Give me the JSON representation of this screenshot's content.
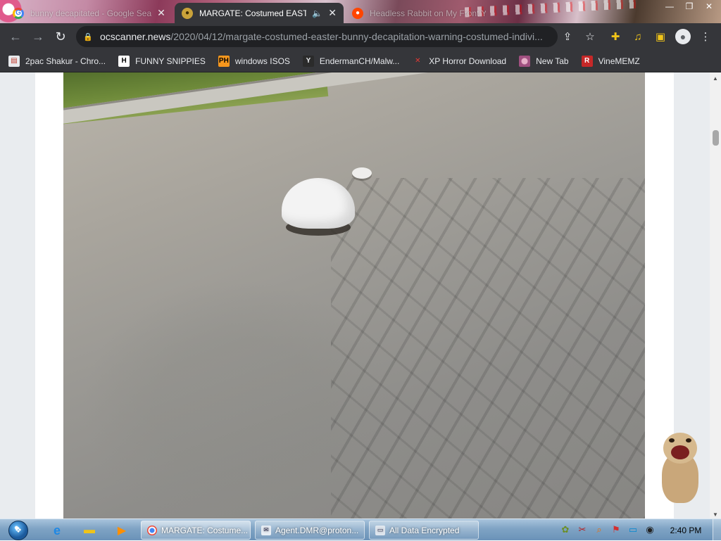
{
  "browser": {
    "tabs": [
      {
        "title": "bunny decapitated - Google Sea",
        "active": false,
        "icon": "google-icon"
      },
      {
        "title": "MARGATE: Costumed EASTE",
        "active": true,
        "icon": "ocscanner-icon",
        "audio": true
      },
      {
        "title": "Headless Rabbit on My Front Ya",
        "active": false,
        "icon": "reddit-icon"
      }
    ],
    "address": {
      "host": "ocscanner.news",
      "path": "/2020/04/12/margate-costumed-easter-bunny-decapitation-warning-costumed-indivi..."
    },
    "bookmarks": [
      {
        "label": "2pac Shakur - Chro...",
        "icon": "2pac-icon"
      },
      {
        "label": "FUNNY SNIPPIES",
        "icon": "h-icon"
      },
      {
        "label": "windows ISOS",
        "icon": "ph-icon"
      },
      {
        "label": "EndermanCH/Malw...",
        "icon": "yt-icon"
      },
      {
        "label": "XP Horror Download",
        "icon": "x-icon"
      },
      {
        "label": "New Tab",
        "icon": "newtab-icon"
      },
      {
        "label": "VineMEMZ",
        "icon": "vine-icon"
      }
    ]
  },
  "taskbar": {
    "buttons": [
      {
        "label": "MARGATE: Costume...",
        "icon": "chrome-icon",
        "active": true
      },
      {
        "label": "Agent.DMR@proton...",
        "icon": "mail-icon",
        "active": false
      },
      {
        "label": "All Data Encrypted",
        "icon": "window-icon",
        "active": false
      }
    ],
    "clock": "2:40 PM"
  }
}
